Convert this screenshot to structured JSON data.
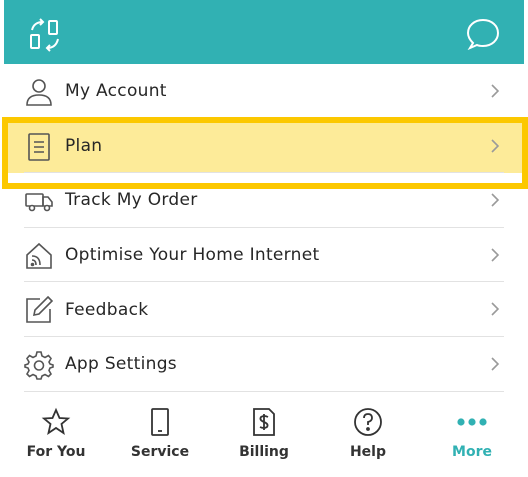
{
  "header": {
    "left_icon": "swap-devices-icon",
    "right_icon": "chat-bubble-icon"
  },
  "menu": {
    "items": [
      {
        "label": "My Account",
        "icon": "person-icon"
      },
      {
        "label": "Plan",
        "icon": "document-icon",
        "highlighted": true
      },
      {
        "label": "Track My Order",
        "icon": "truck-icon"
      },
      {
        "label": "Optimise Your Home Internet",
        "icon": "home-wifi-icon"
      },
      {
        "label": "Feedback",
        "icon": "edit-icon"
      },
      {
        "label": "App Settings",
        "icon": "gear-icon"
      }
    ]
  },
  "tabbar": {
    "tabs": [
      {
        "label": "For You",
        "icon": "star-icon"
      },
      {
        "label": "Service",
        "icon": "device-icon"
      },
      {
        "label": "Billing",
        "icon": "bill-icon"
      },
      {
        "label": "Help",
        "icon": "question-icon"
      },
      {
        "label": "More",
        "icon": "more-dots-icon",
        "active": true
      }
    ]
  },
  "colors": {
    "brand": "#31b1b3",
    "highlight_fill": "#fdeb99",
    "highlight_border": "#fcc800"
  }
}
